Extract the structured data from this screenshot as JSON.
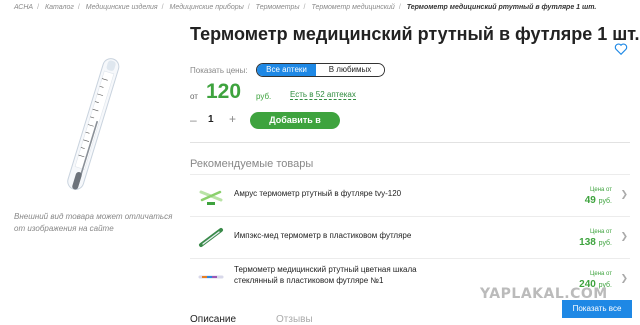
{
  "breadcrumb": {
    "items": [
      "АСНА",
      "Каталог",
      "Медицинские изделия",
      "Медицинские приборы",
      "Термометры",
      "Термометр медицинский"
    ],
    "current": "Термометр медицинский ртутный в футляре 1 шт."
  },
  "product": {
    "title": "Термометр медицинский ртутный в футляре 1 шт.",
    "image_note": "Внешний вид товара может отличаться от изображения на сайте",
    "price_label": "Показать цены:",
    "price_toggle": {
      "all": "Все аптеки",
      "favorites": "В любимых"
    },
    "price_from": "от",
    "price_value": "120",
    "price_currency": "руб.",
    "in_stock": "Есть в 52 аптеках",
    "quantity": "1",
    "qty_minus": "–",
    "qty_plus": "+",
    "add_button": "Добавить в"
  },
  "recommended": {
    "title": "Рекомендуемые товары",
    "items": [
      {
        "name": "Амрус термометр ртутный в футляре tvy-120",
        "from": "Цена от",
        "price": "49",
        "currency": "руб."
      },
      {
        "name": "Импэкс-мед термометр в пластиковом футляре",
        "from": "Цена от",
        "price": "138",
        "currency": "руб."
      },
      {
        "name": "Термометр медицинский ртутный цветная шкала стеклянный в пластиковом футляре №1",
        "from": "Цена от",
        "price": "240",
        "currency": "руб."
      }
    ]
  },
  "tabs": {
    "description": "Описание",
    "reviews": "Отзывы"
  },
  "show_all": "Показать все",
  "watermark": "YAPLAKAL.COM",
  "colors": {
    "accent_green": "#3ea33e",
    "accent_blue": "#1e88e5"
  }
}
